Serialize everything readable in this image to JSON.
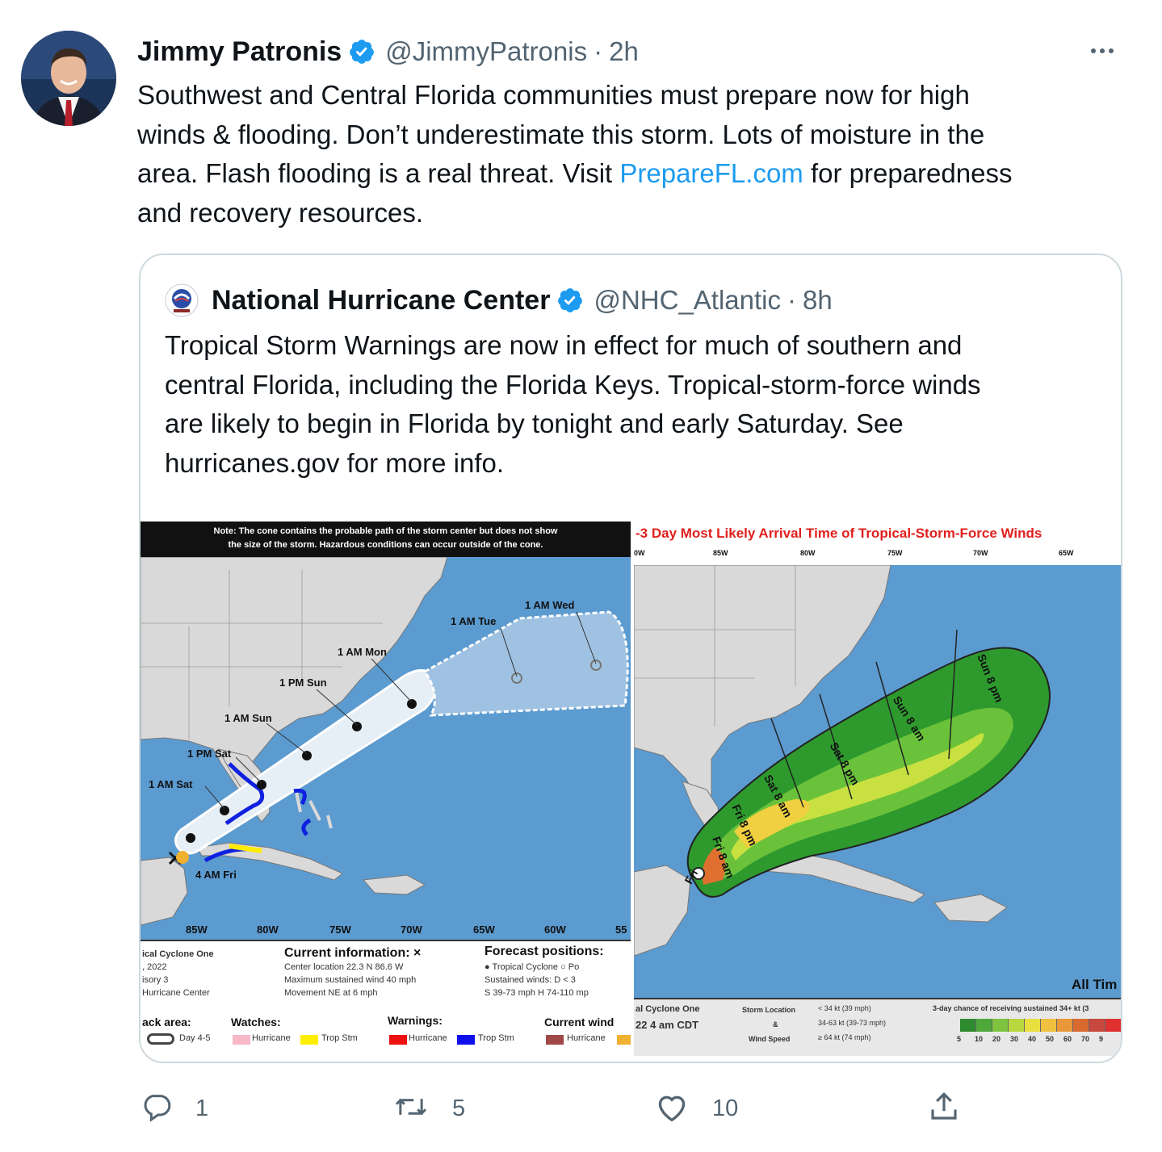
{
  "tweet": {
    "author_name": "Jimmy Patronis",
    "handle": "@JimmyPatronis",
    "separator": "·",
    "time": "2h",
    "lines": [
      "Southwest and Central Florida communities must prepare now for high",
      "winds & flooding. Don’t underestimate this storm. Lots of moisture in the",
      "area. Flash flooding is a real threat. Visit ",
      "and recovery resources."
    ],
    "link_text": "PrepareFL.com",
    "after_link": " for preparedness"
  },
  "quoted": {
    "author_name": "National Hurricane Center",
    "handle": "@NHC_Atlantic",
    "separator": "·",
    "time": "8h",
    "lines": [
      "Tropical Storm Warnings are now in effect for much of southern and",
      "central Florida, including the Florida Keys. Tropical-storm-force winds",
      "are likely to begin in Florida by tonight and early Saturday. See",
      "hurricanes.gov for more info."
    ]
  },
  "map_left": {
    "note": [
      "Note: The cone contains the probable path of the storm center but does not show",
      "the size of the storm. Hazardous conditions can occur outside of the cone."
    ],
    "track_labels": [
      "1 AM Wed",
      "1 AM Tue",
      "1 AM Mon",
      "1 PM Sun",
      "1 AM Sun",
      "1 PM Sat",
      "1 AM Sat",
      "4 AM Fri"
    ],
    "axis": [
      "85W",
      "80W",
      "75W",
      "70W",
      "65W",
      "60W",
      "55"
    ],
    "legend": {
      "storm_name": "ical Cyclone One",
      "date": ", 2022",
      "advisory": "isory 3",
      "center": "Hurricane Center",
      "current_title": "Current information: ×",
      "current_lines": [
        "Center location 22.3 N 86.6 W",
        "Maximum sustained wind 40 mph",
        "Movement NE at 6 mph"
      ],
      "forecast_title": "Forecast positions:",
      "forecast_lines": [
        "● Tropical Cyclone  ○ Po",
        "Sustained winds:          D < 3",
        "S 39-73 mph  H 74-110 mp"
      ],
      "track_area": "ack area:",
      "day45": "Day 4-5",
      "watches": "Watches:",
      "warnings": "Warnings:",
      "current_wind": "Current wind",
      "hurricane": "Hurricane",
      "trop_stm": "Trop Stm"
    }
  },
  "map_right": {
    "title": "-3 Day Most Likely Arrival Time of Tropical-Storm-Force Winds",
    "axis": [
      "0W",
      "85W",
      "80W",
      "75W",
      "70W",
      "65W"
    ],
    "swath_labels": [
      "Sun 8 pm",
      "Sun 8 am",
      "Sat 8 pm",
      "Sat 8 am",
      "Fri 8 pm",
      "Fri 8 am",
      "Fri"
    ],
    "corner_text": "All Tim",
    "legend": {
      "storm": "al Cyclone One",
      "time": "22  4 am CDT",
      "storm_location": "Storm Location",
      "and": "&",
      "wind_speed": "Wind Speed",
      "wind_lines": [
        "< 34 kt (39 mph)",
        "34-63 kt (39-73 mph)",
        "≥ 64 kt (74 mph)"
      ],
      "chance": "3-day chance of receiving sustained 34+ kt (3",
      "scale": [
        "5",
        "10",
        "20",
        "30",
        "40",
        "50",
        "60",
        "70",
        "9"
      ]
    }
  },
  "actions": {
    "reply_count": "1",
    "retweet_count": "5",
    "like_count": "10"
  },
  "colors": {
    "link": "#1d9bf0",
    "verified": "#1d9bf0",
    "secondary_text": "#536471",
    "ocean": "#5b9bd0",
    "land": "#d9d9d9"
  },
  "icons": [
    "verified-badge-icon",
    "more-options-icon",
    "reply-icon",
    "retweet-icon",
    "like-icon",
    "share-icon"
  ]
}
